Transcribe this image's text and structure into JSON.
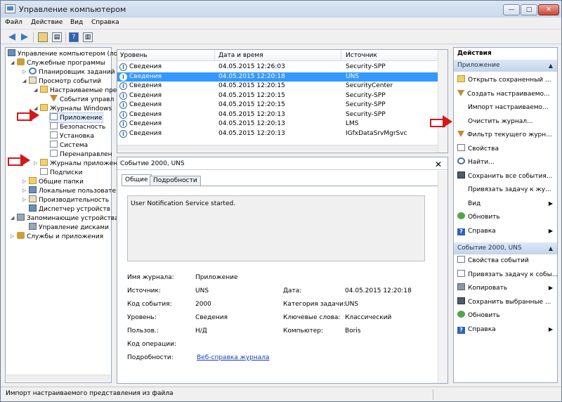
{
  "window": {
    "title": "Управление компьютером",
    "min": "—",
    "max": "□",
    "close": "✕"
  },
  "menu": [
    "Файл",
    "Действие",
    "Вид",
    "Справка"
  ],
  "tree": [
    {
      "label": "Управление компьютером (ло",
      "depth": 0
    },
    {
      "label": "Служебные программы",
      "depth": 1
    },
    {
      "label": "Планировщик заданий",
      "depth": 2
    },
    {
      "label": "Просмотр событий",
      "depth": 2
    },
    {
      "label": "Настраиваемые пре",
      "depth": 3
    },
    {
      "label": "События управл",
      "depth": 4
    },
    {
      "label": "Журналы Windows",
      "depth": 3
    },
    {
      "label": "Приложение",
      "depth": 4
    },
    {
      "label": "Безопасность",
      "depth": 4
    },
    {
      "label": "Установка",
      "depth": 4
    },
    {
      "label": "Система",
      "depth": 4
    },
    {
      "label": "Перенаправлен",
      "depth": 4
    },
    {
      "label": "Журналы приложен",
      "depth": 3
    },
    {
      "label": "Подписки",
      "depth": 3
    },
    {
      "label": "Общие папки",
      "depth": 2
    },
    {
      "label": "Локальные пользовате",
      "depth": 2
    },
    {
      "label": "Производительность",
      "depth": 2
    },
    {
      "label": "Диспетчер устройств",
      "depth": 2
    },
    {
      "label": "Запоминающие устройства",
      "depth": 1
    },
    {
      "label": "Управление дисками",
      "depth": 2
    },
    {
      "label": "Службы и приложения",
      "depth": 1
    }
  ],
  "event_table": {
    "columns": [
      "Уровень",
      "Дата и время",
      "Источник"
    ],
    "rows": [
      {
        "level": "Сведения",
        "date": "04.05.2015 12:26:03",
        "source": "Security-SPP"
      },
      {
        "level": "Сведения",
        "date": "04.05.2015 12:20:18",
        "source": "UNS"
      },
      {
        "level": "Сведения",
        "date": "04.05.2015 12:20:15",
        "source": "SecurityCenter"
      },
      {
        "level": "Сведения",
        "date": "04.05.2015 12:20:15",
        "source": "Security-SPP"
      },
      {
        "level": "Сведения",
        "date": "04.05.2015 12:20:15",
        "source": "Security-SPP"
      },
      {
        "level": "Сведения",
        "date": "04.05.2015 12:20:13",
        "source": "Security-SPP"
      },
      {
        "level": "Сведения",
        "date": "04.05.2015 12:20:13",
        "source": "LMS"
      },
      {
        "level": "Сведения",
        "date": "04.05.2015 12:20:13",
        "source": "IGfxDataSrvMgrSvc"
      }
    ]
  },
  "event_detail": {
    "header": "Событие 2000, UNS",
    "tabs": [
      "Общие",
      "Подробности"
    ],
    "description": "User Notification Service started.",
    "log_name_label": "Имя журнала:",
    "log_name": "Приложение",
    "source_label": "Источник:",
    "source": "UNS",
    "date_label": "Дата:",
    "date": "04.05.2015 12:20:18",
    "event_id_label": "Код события:",
    "event_id": "2000",
    "task_cat_label": "Категория задачи:",
    "task_cat": "UNS",
    "level_label": "Уровень:",
    "level": "Сведения",
    "keywords_label": "Ключевые слова:",
    "keywords": "Классический",
    "user_label": "Пользов.:",
    "user": "Н/Д",
    "computer_label": "Компьютер:",
    "computer": "Boris",
    "opcode_label": "Код операции:",
    "more_label": "Подробности:",
    "more_link": "Веб-справка журнала"
  },
  "actions": {
    "title": "Действия",
    "section1": "Приложение",
    "section1_items": [
      {
        "label": "Открыть сохраненный ...",
        "icon": "folder-icon"
      },
      {
        "label": "Создать настраиваемо...",
        "icon": "filter-icon"
      },
      {
        "label": "Импорт настраиваемо...",
        "icon": "blank"
      },
      {
        "label": "Очистить журнал...",
        "icon": "blank"
      },
      {
        "label": "Фильтр текущего журн...",
        "icon": "filter-icon"
      },
      {
        "label": "Свойства",
        "icon": "properties-icon"
      },
      {
        "label": "Найти...",
        "icon": "find-icon"
      },
      {
        "label": "Сохранить все события...",
        "icon": "save-icon"
      },
      {
        "label": "Привязать задачу к жу...",
        "icon": "blank"
      },
      {
        "label": "Вид",
        "icon": "blank",
        "sub": true
      },
      {
        "label": "Обновить",
        "icon": "refresh-icon"
      },
      {
        "label": "Справка",
        "icon": "help-icon",
        "sub": true
      }
    ],
    "section2": "Событие 2000, UNS",
    "section2_items": [
      {
        "label": "Свойства событий",
        "icon": "properties-icon"
      },
      {
        "label": "Привязать задачу к собы...",
        "icon": "task-icon"
      },
      {
        "label": "Копировать",
        "icon": "copy-icon",
        "sub": true
      },
      {
        "label": "Сохранить выбранные ...",
        "icon": "save-icon"
      },
      {
        "label": "Обновить",
        "icon": "refresh-icon"
      },
      {
        "label": "Справка",
        "icon": "help-icon",
        "sub": true
      }
    ]
  },
  "status_bar": "Импорт настраиваемого представления из файла",
  "colors": {
    "selection": "#3399ff",
    "arrow": "#d4181a",
    "link": "#1a3fb5"
  }
}
